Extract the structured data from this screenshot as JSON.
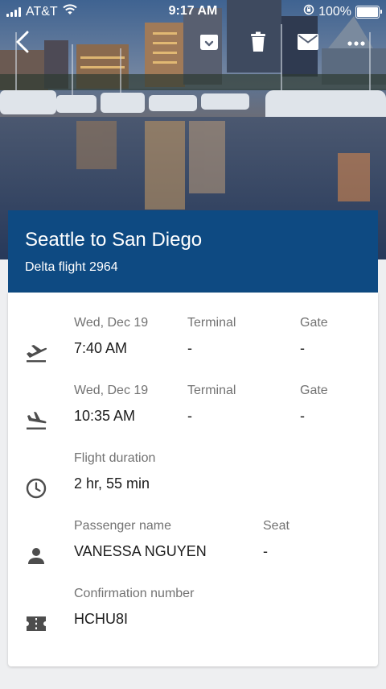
{
  "status_bar": {
    "carrier": "AT&T",
    "time": "9:17 AM",
    "battery": "100%"
  },
  "header": {
    "title": "Seattle to San Diego",
    "subtitle": "Delta flight 2964"
  },
  "departure": {
    "date": "Wed, Dec 19",
    "time": "7:40 AM",
    "terminal_label": "Terminal",
    "terminal_value": "-",
    "gate_label": "Gate",
    "gate_value": "-"
  },
  "arrival": {
    "date": "Wed, Dec 19",
    "time": "10:35 AM",
    "terminal_label": "Terminal",
    "terminal_value": "-",
    "gate_label": "Gate",
    "gate_value": "-"
  },
  "duration": {
    "label": "Flight duration",
    "value": "2 hr, 55 min"
  },
  "passenger": {
    "label": "Passenger name",
    "value": "VANESSA NGUYEN",
    "seat_label": "Seat",
    "seat_value": "-"
  },
  "confirmation": {
    "label": "Confirmation number",
    "value": "HCHU8I"
  },
  "icons": {
    "back": "arrow-back-icon",
    "archive": "archive-icon",
    "delete": "trash-icon",
    "email": "email-icon",
    "more": "more-icon",
    "departure": "flight-takeoff-icon",
    "arrival": "flight-land-icon",
    "duration": "clock-icon",
    "passenger": "person-icon",
    "confirmation": "ticket-icon"
  },
  "colors": {
    "header_bg": "#0e4a82",
    "label": "#727272",
    "value": "#1c1c1c",
    "icon": "#4d4d4d"
  }
}
